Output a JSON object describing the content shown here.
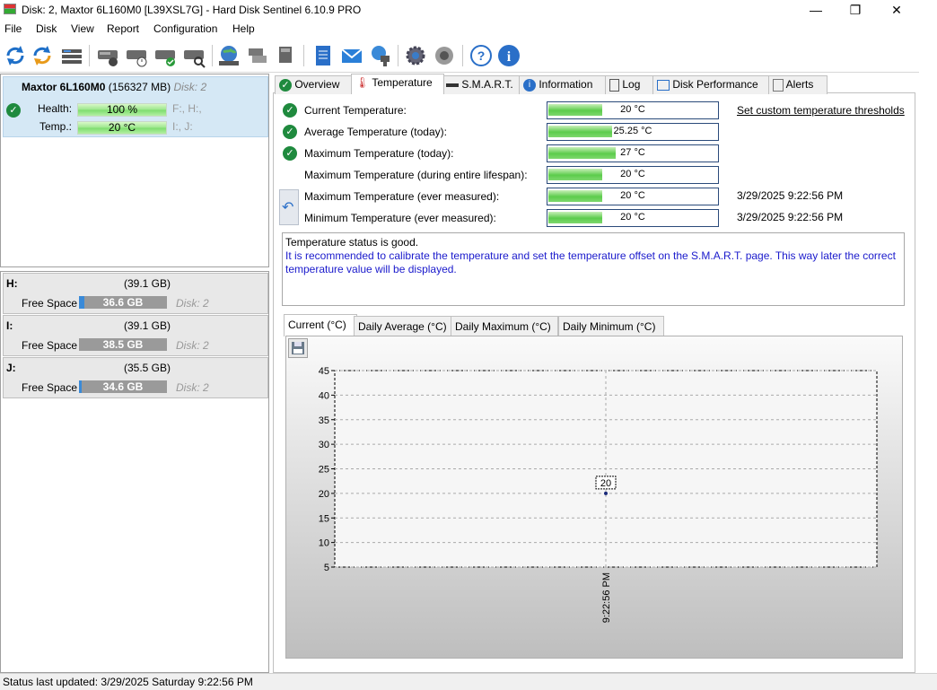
{
  "window": {
    "title": "Disk: 2, Maxtor 6L160M0 [L39XSL7G]  -  Hard Disk Sentinel 6.10.9 PRO",
    "minimize": "—",
    "maximize": "❐",
    "close": "✕"
  },
  "menu": [
    {
      "label": "File"
    },
    {
      "label": "Disk"
    },
    {
      "label": "View"
    },
    {
      "label": "Report"
    },
    {
      "label": "Configuration"
    },
    {
      "label": "Help"
    }
  ],
  "disk": {
    "name": "Maxtor 6L160M0",
    "size": "(156327 MB)",
    "disk_label": "Disk: 2",
    "health_label": "Health:",
    "health_value": "100 %",
    "health_fraction": 1.0,
    "health_drives": "F:, H:,",
    "temp_label": "Temp.:",
    "temp_value": "20 °C",
    "temp_drives": "I:, J:"
  },
  "partitions": [
    {
      "letter": "H:",
      "size": "(39.1 GB)",
      "free_label": "Free Space",
      "free": "36.6 GB",
      "used_fraction": 0.06,
      "disk": "Disk: 2"
    },
    {
      "letter": "I:",
      "size": "(39.1 GB)",
      "free_label": "Free Space",
      "free": "38.5 GB",
      "used_fraction": 0.0,
      "disk": "Disk: 2"
    },
    {
      "letter": "J:",
      "size": "(35.5 GB)",
      "free_label": "Free Space",
      "free": "34.6 GB",
      "used_fraction": 0.03,
      "disk": "Disk: 2"
    }
  ],
  "tabs": [
    {
      "label": "Overview"
    },
    {
      "label": "Temperature"
    },
    {
      "label": "S.M.A.R.T."
    },
    {
      "label": "Information"
    },
    {
      "label": "Log"
    },
    {
      "label": "Disk Performance"
    },
    {
      "label": "Alerts"
    }
  ],
  "temperature": {
    "rows": [
      {
        "label": "Current Temperature:",
        "value": "20 °C",
        "fill": 0.32,
        "ok": true,
        "date": ""
      },
      {
        "label": "Average Temperature (today):",
        "value": "25.25 °C",
        "fill": 0.38,
        "ok": true,
        "date": ""
      },
      {
        "label": "Maximum Temperature (today):",
        "value": "27 °C",
        "fill": 0.4,
        "ok": true,
        "date": ""
      },
      {
        "label": "Maximum Temperature (during entire lifespan):",
        "value": "20 °C",
        "fill": 0.32,
        "ok": false,
        "date": ""
      },
      {
        "label": "Maximum Temperature (ever measured):",
        "value": "20 °C",
        "fill": 0.32,
        "ok": false,
        "date": "3/29/2025 9:22:56 PM"
      },
      {
        "label": "Minimum Temperature (ever measured):",
        "value": "20 °C",
        "fill": 0.32,
        "ok": false,
        "date": "3/29/2025 9:22:56 PM"
      }
    ],
    "threshold_link": "Set custom temperature thresholds",
    "status_line": "Temperature status is good.",
    "recommendation": "It is recommended to calibrate the temperature and set the temperature offset on the S.M.A.R.T. page. This way later the correct temperature value will be displayed."
  },
  "chart_tabs": [
    {
      "label": "Current (°C)"
    },
    {
      "label": "Daily Average (°C)"
    },
    {
      "label": "Daily Maximum (°C)"
    },
    {
      "label": "Daily Minimum (°C)"
    }
  ],
  "chart_data": {
    "type": "scatter",
    "title": "",
    "xlabel": "",
    "ylabel": "",
    "ylim": [
      5,
      45
    ],
    "yticks": [
      5,
      10,
      15,
      20,
      25,
      30,
      35,
      40,
      45
    ],
    "grid": true,
    "points": [
      {
        "x": "9:22:56 PM",
        "y": 20,
        "label": "20"
      }
    ]
  },
  "status": {
    "text": "Status last updated: 3/29/2025 Saturday 9:22:56 PM"
  },
  "icons": [
    "refresh-icon",
    "refresh-all-icon",
    "disk-list-icon",
    "disk-info-icon",
    "disk-timer-icon",
    "disk-check-icon",
    "disk-search-icon",
    "globe-icon",
    "disk-copy-icon",
    "disk-external-icon",
    "report-notepad-icon",
    "mail-icon",
    "network-icon",
    "settings-gear-icon",
    "speaker-icon",
    "help-icon",
    "info-icon"
  ]
}
